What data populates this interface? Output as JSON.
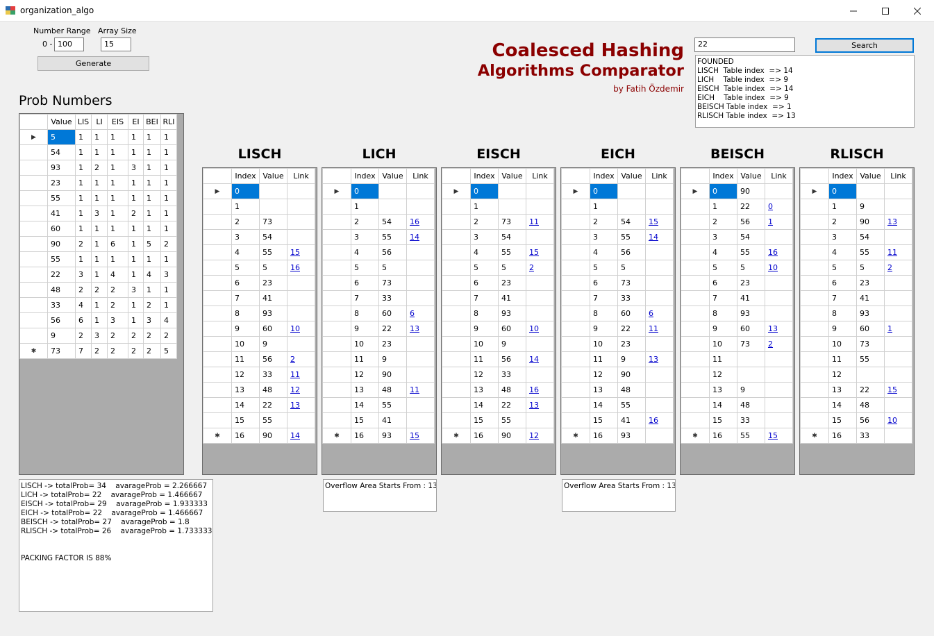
{
  "window": {
    "title": "organization_algo"
  },
  "controls": {
    "number_range_label": "Number Range",
    "range_prefix": "0 -",
    "range_max": "100",
    "array_size_label": "Array Size",
    "array_size": "15",
    "generate_label": "Generate",
    "search_value": "22",
    "search_label": "Search"
  },
  "branding": {
    "line1": "Coalesced Hashing",
    "line2": "Algorithms Comparator",
    "author": "by Fatih Özdemir"
  },
  "search_result": "FOUNDED\nLISCH  Table index  => 14\nLICH    Table index  => 9\nEISCH  Table index  => 14\nEICH    Table index  => 9\nBEISCH Table index  => 1\nRLISCH Table index  => 13",
  "prob": {
    "title": "Prob Numbers",
    "headers": [
      "Value",
      "LIS",
      "LI",
      "EIS",
      "EI",
      "BEI",
      "RLI"
    ],
    "rows": [
      [
        "5",
        "1",
        "1",
        "1",
        "1",
        "1",
        "1"
      ],
      [
        "54",
        "1",
        "1",
        "1",
        "1",
        "1",
        "1"
      ],
      [
        "93",
        "1",
        "2",
        "1",
        "3",
        "1",
        "1"
      ],
      [
        "23",
        "1",
        "1",
        "1",
        "1",
        "1",
        "1"
      ],
      [
        "55",
        "1",
        "1",
        "1",
        "1",
        "1",
        "1"
      ],
      [
        "41",
        "1",
        "3",
        "1",
        "2",
        "1",
        "1"
      ],
      [
        "60",
        "1",
        "1",
        "1",
        "1",
        "1",
        "1"
      ],
      [
        "90",
        "2",
        "1",
        "6",
        "1",
        "5",
        "2"
      ],
      [
        "55",
        "1",
        "1",
        "1",
        "1",
        "1",
        "1"
      ],
      [
        "22",
        "3",
        "1",
        "4",
        "1",
        "4",
        "3"
      ],
      [
        "48",
        "2",
        "2",
        "2",
        "3",
        "1",
        "1"
      ],
      [
        "33",
        "4",
        "1",
        "2",
        "1",
        "2",
        "1"
      ],
      [
        "56",
        "6",
        "1",
        "3",
        "1",
        "3",
        "4"
      ],
      [
        "9",
        "2",
        "3",
        "2",
        "2",
        "2",
        "2"
      ],
      [
        "73",
        "7",
        "2",
        "2",
        "2",
        "2",
        "5"
      ]
    ]
  },
  "table_headers": [
    "Index",
    "Value",
    "Link"
  ],
  "tables": [
    {
      "name": "LISCH",
      "rows": [
        [
          "0",
          "",
          ""
        ],
        [
          "1",
          "",
          ""
        ],
        [
          "2",
          "73",
          ""
        ],
        [
          "3",
          "54",
          ""
        ],
        [
          "4",
          "55",
          "15"
        ],
        [
          "5",
          "5",
          "16"
        ],
        [
          "6",
          "23",
          ""
        ],
        [
          "7",
          "41",
          ""
        ],
        [
          "8",
          "93",
          ""
        ],
        [
          "9",
          "60",
          "10"
        ],
        [
          "10",
          "9",
          ""
        ],
        [
          "11",
          "56",
          "2"
        ],
        [
          "12",
          "33",
          "11"
        ],
        [
          "13",
          "48",
          "12"
        ],
        [
          "14",
          "22",
          "13"
        ],
        [
          "15",
          "55",
          ""
        ],
        [
          "16",
          "90",
          "14"
        ]
      ]
    },
    {
      "name": "LICH",
      "rows": [
        [
          "0",
          "",
          ""
        ],
        [
          "1",
          "",
          ""
        ],
        [
          "2",
          "54",
          "16"
        ],
        [
          "3",
          "55",
          "14"
        ],
        [
          "4",
          "56",
          ""
        ],
        [
          "5",
          "5",
          ""
        ],
        [
          "6",
          "73",
          ""
        ],
        [
          "7",
          "33",
          ""
        ],
        [
          "8",
          "60",
          "6"
        ],
        [
          "9",
          "22",
          "13"
        ],
        [
          "10",
          "23",
          ""
        ],
        [
          "11",
          "9",
          ""
        ],
        [
          "12",
          "90",
          ""
        ],
        [
          "13",
          "48",
          "11"
        ],
        [
          "14",
          "55",
          ""
        ],
        [
          "15",
          "41",
          ""
        ],
        [
          "16",
          "93",
          "15"
        ]
      ]
    },
    {
      "name": "EISCH",
      "rows": [
        [
          "0",
          "",
          ""
        ],
        [
          "1",
          "",
          ""
        ],
        [
          "2",
          "73",
          "11"
        ],
        [
          "3",
          "54",
          ""
        ],
        [
          "4",
          "55",
          "15"
        ],
        [
          "5",
          "5",
          "2"
        ],
        [
          "6",
          "23",
          ""
        ],
        [
          "7",
          "41",
          ""
        ],
        [
          "8",
          "93",
          ""
        ],
        [
          "9",
          "60",
          "10"
        ],
        [
          "10",
          "9",
          ""
        ],
        [
          "11",
          "56",
          "14"
        ],
        [
          "12",
          "33",
          ""
        ],
        [
          "13",
          "48",
          "16"
        ],
        [
          "14",
          "22",
          "13"
        ],
        [
          "15",
          "55",
          ""
        ],
        [
          "16",
          "90",
          "12"
        ]
      ]
    },
    {
      "name": "EICH",
      "rows": [
        [
          "0",
          "",
          ""
        ],
        [
          "1",
          "",
          ""
        ],
        [
          "2",
          "54",
          "15"
        ],
        [
          "3",
          "55",
          "14"
        ],
        [
          "4",
          "56",
          ""
        ],
        [
          "5",
          "5",
          ""
        ],
        [
          "6",
          "73",
          ""
        ],
        [
          "7",
          "33",
          ""
        ],
        [
          "8",
          "60",
          "6"
        ],
        [
          "9",
          "22",
          "11"
        ],
        [
          "10",
          "23",
          ""
        ],
        [
          "11",
          "9",
          "13"
        ],
        [
          "12",
          "90",
          ""
        ],
        [
          "13",
          "48",
          ""
        ],
        [
          "14",
          "55",
          ""
        ],
        [
          "15",
          "41",
          "16"
        ],
        [
          "16",
          "93",
          ""
        ]
      ]
    },
    {
      "name": "BEISCH",
      "rows": [
        [
          "0",
          "90",
          ""
        ],
        [
          "1",
          "22",
          "0"
        ],
        [
          "2",
          "56",
          "1"
        ],
        [
          "3",
          "54",
          ""
        ],
        [
          "4",
          "55",
          "16"
        ],
        [
          "5",
          "5",
          "10"
        ],
        [
          "6",
          "23",
          ""
        ],
        [
          "7",
          "41",
          ""
        ],
        [
          "8",
          "93",
          ""
        ],
        [
          "9",
          "60",
          "13"
        ],
        [
          "10",
          "73",
          "2"
        ],
        [
          "11",
          "",
          ""
        ],
        [
          "12",
          "",
          ""
        ],
        [
          "13",
          "9",
          ""
        ],
        [
          "14",
          "48",
          ""
        ],
        [
          "15",
          "33",
          ""
        ],
        [
          "16",
          "55",
          "15"
        ]
      ]
    },
    {
      "name": "RLISCH",
      "rows": [
        [
          "0",
          "",
          ""
        ],
        [
          "1",
          "9",
          ""
        ],
        [
          "2",
          "90",
          "13"
        ],
        [
          "3",
          "54",
          ""
        ],
        [
          "4",
          "55",
          "11"
        ],
        [
          "5",
          "5",
          "2"
        ],
        [
          "6",
          "23",
          ""
        ],
        [
          "7",
          "41",
          ""
        ],
        [
          "8",
          "93",
          ""
        ],
        [
          "9",
          "60",
          "1"
        ],
        [
          "10",
          "73",
          ""
        ],
        [
          "11",
          "55",
          ""
        ],
        [
          "12",
          "",
          ""
        ],
        [
          "13",
          "22",
          "15"
        ],
        [
          "14",
          "48",
          ""
        ],
        [
          "15",
          "56",
          "10"
        ],
        [
          "16",
          "33",
          ""
        ]
      ]
    }
  ],
  "overflow": {
    "lich": "Overflow Area Starts From : 13",
    "eich": "Overflow Area Starts From : 13"
  },
  "stats": "LISCH -> totalProb= 34    avarageProb = 2.266667\nLICH -> totalProb= 22    avarageProb = 1.466667\nEISCH -> totalProb= 29    avarageProb = 1.933333\nEICH -> totalProb= 22    avarageProb = 1.466667\nBEISCH -> totalProb= 27    avarageProb = 1.8\nRLISCH -> totalProb= 26    avarageProb = 1.733333\n\n\nPACKING FACTOR IS 88%"
}
